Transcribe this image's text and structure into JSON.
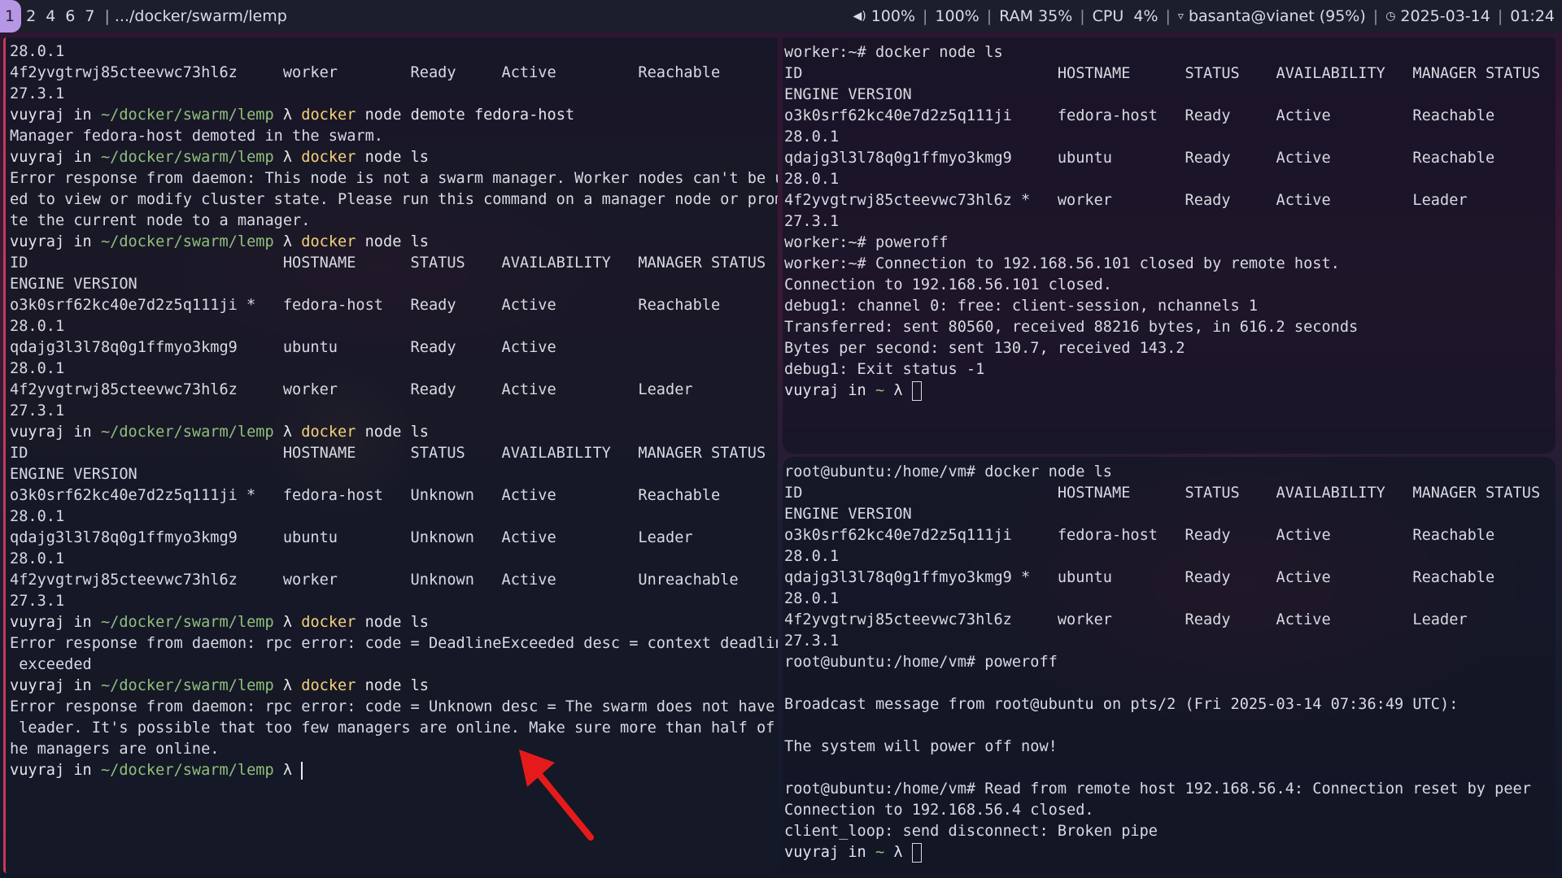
{
  "topbar": {
    "workspaces": [
      "1",
      "2",
      "4",
      "6",
      "7"
    ],
    "active_workspace": "1",
    "title": ".../docker/swarm/lemp",
    "volume": "100%",
    "brightness": "100%",
    "ram": "RAM 35%",
    "cpu": "CPU  4%",
    "wifi": "basanta@vianet (95%)",
    "date": "2025-03-14",
    "time": "01:24",
    "icons": {
      "volume": "speaker-icon",
      "wifi": "wifi-icon",
      "clock": "clock-icon"
    }
  },
  "colors": {
    "accent": "#b796e6",
    "prompt_path": "#8ec07c",
    "command": "#f4d27a",
    "red_arrow": "#e51b1b"
  },
  "left_terminal": {
    "lines": [
      "28.0.1",
      "4f2yvgtrwj85cteevwc73hl6z     worker        Ready     Active         Reachable",
      "27.3.1",
      {
        "prompt": true,
        "user": "vuyraj in ",
        "path": "~/docker/swarm/lemp",
        "sym": " λ ",
        "cmd": "docker",
        "args": " node demote fedora-host"
      },
      "Manager fedora-host demoted in the swarm.",
      {
        "prompt": true,
        "user": "vuyraj in ",
        "path": "~/docker/swarm/lemp",
        "sym": " λ ",
        "cmd": "docker",
        "args": " node ls"
      },
      "Error response from daemon: This node is not a swarm manager. Worker nodes can't be us",
      "ed to view or modify cluster state. Please run this command on a manager node or promo",
      "te the current node to a manager.",
      {
        "prompt": true,
        "user": "vuyraj in ",
        "path": "~/docker/swarm/lemp",
        "sym": " λ ",
        "cmd": "docker",
        "args": " node ls"
      },
      "ID                            HOSTNAME      STATUS    AVAILABILITY   MANAGER STATUS",
      "ENGINE VERSION",
      "o3k0srf62kc40e7d2z5q111ji *   fedora-host   Ready     Active         Reachable",
      "28.0.1",
      "qdajg3l3l78q0g1ffmyo3kmg9     ubuntu        Ready     Active",
      "28.0.1",
      "4f2yvgtrwj85cteevwc73hl6z     worker        Ready     Active         Leader",
      "27.3.1",
      {
        "prompt": true,
        "user": "vuyraj in ",
        "path": "~/docker/swarm/lemp",
        "sym": " λ ",
        "cmd": "docker",
        "args": " node ls"
      },
      "ID                            HOSTNAME      STATUS    AVAILABILITY   MANAGER STATUS",
      "ENGINE VERSION",
      "o3k0srf62kc40e7d2z5q111ji *   fedora-host   Unknown   Active         Reachable",
      "28.0.1",
      "qdajg3l3l78q0g1ffmyo3kmg9     ubuntu        Unknown   Active         Leader",
      "28.0.1",
      "4f2yvgtrwj85cteevwc73hl6z     worker        Unknown   Active         Unreachable",
      "27.3.1",
      {
        "prompt": true,
        "user": "vuyraj in ",
        "path": "~/docker/swarm/lemp",
        "sym": " λ ",
        "cmd": "docker",
        "args": " node ls"
      },
      "Error response from daemon: rpc error: code = DeadlineExceeded desc = context deadline",
      " exceeded",
      {
        "prompt": true,
        "user": "vuyraj in ",
        "path": "~/docker/swarm/lemp",
        "sym": " λ ",
        "cmd": "docker",
        "args": " node ls"
      },
      "Error response from daemon: rpc error: code = Unknown desc = The swarm does not have a",
      " leader. It's possible that too few managers are online. Make sure more than half of t",
      "he managers are online.",
      {
        "prompt": true,
        "user": "vuyraj in ",
        "path": "~/docker/swarm/lemp",
        "sym": " λ ",
        "cmd": "",
        "args": "",
        "cursor": "bar"
      }
    ]
  },
  "top_right_terminal": {
    "lines": [
      "worker:~# docker node ls",
      "ID                            HOSTNAME      STATUS    AVAILABILITY   MANAGER STATUS",
      "ENGINE VERSION",
      "o3k0srf62kc40e7d2z5q111ji     fedora-host   Ready     Active         Reachable",
      "28.0.1",
      "qdajg3l3l78q0g1ffmyo3kmg9     ubuntu        Ready     Active         Reachable",
      "28.0.1",
      "4f2yvgtrwj85cteevwc73hl6z *   worker        Ready     Active         Leader",
      "27.3.1",
      "worker:~# poweroff",
      "worker:~# Connection to 192.168.56.101 closed by remote host.",
      "Connection to 192.168.56.101 closed.",
      "debug1: channel 0: free: client-session, nchannels 1",
      "Transferred: sent 80560, received 88216 bytes, in 616.2 seconds",
      "Bytes per second: sent 130.7, received 143.2",
      "debug1: Exit status -1",
      {
        "prompt": true,
        "user": "vuyraj in ",
        "path": "~",
        "sym": " λ ",
        "cmd": "",
        "args": "",
        "cursor": "box"
      }
    ]
  },
  "bottom_right_terminal": {
    "lines": [
      "root@ubuntu:/home/vm# docker node ls",
      "ID                            HOSTNAME      STATUS    AVAILABILITY   MANAGER STATUS",
      "ENGINE VERSION",
      "o3k0srf62kc40e7d2z5q111ji     fedora-host   Ready     Active         Reachable",
      "28.0.1",
      "qdajg3l3l78q0g1ffmyo3kmg9 *   ubuntu        Ready     Active         Reachable",
      "28.0.1",
      "4f2yvgtrwj85cteevwc73hl6z     worker        Ready     Active         Leader",
      "27.3.1",
      "root@ubuntu:/home/vm# poweroff",
      "",
      "Broadcast message from root@ubuntu on pts/2 (Fri 2025-03-14 07:36:49 UTC):",
      "",
      "The system will power off now!",
      "",
      "root@ubuntu:/home/vm# Read from remote host 192.168.56.4: Connection reset by peer",
      "Connection to 192.168.56.4 closed.",
      "client_loop: send disconnect: Broken pipe",
      {
        "prompt": true,
        "user": "vuyraj in ",
        "path": "~",
        "sym": " λ ",
        "cmd": "",
        "args": "",
        "cursor": "box"
      }
    ]
  }
}
